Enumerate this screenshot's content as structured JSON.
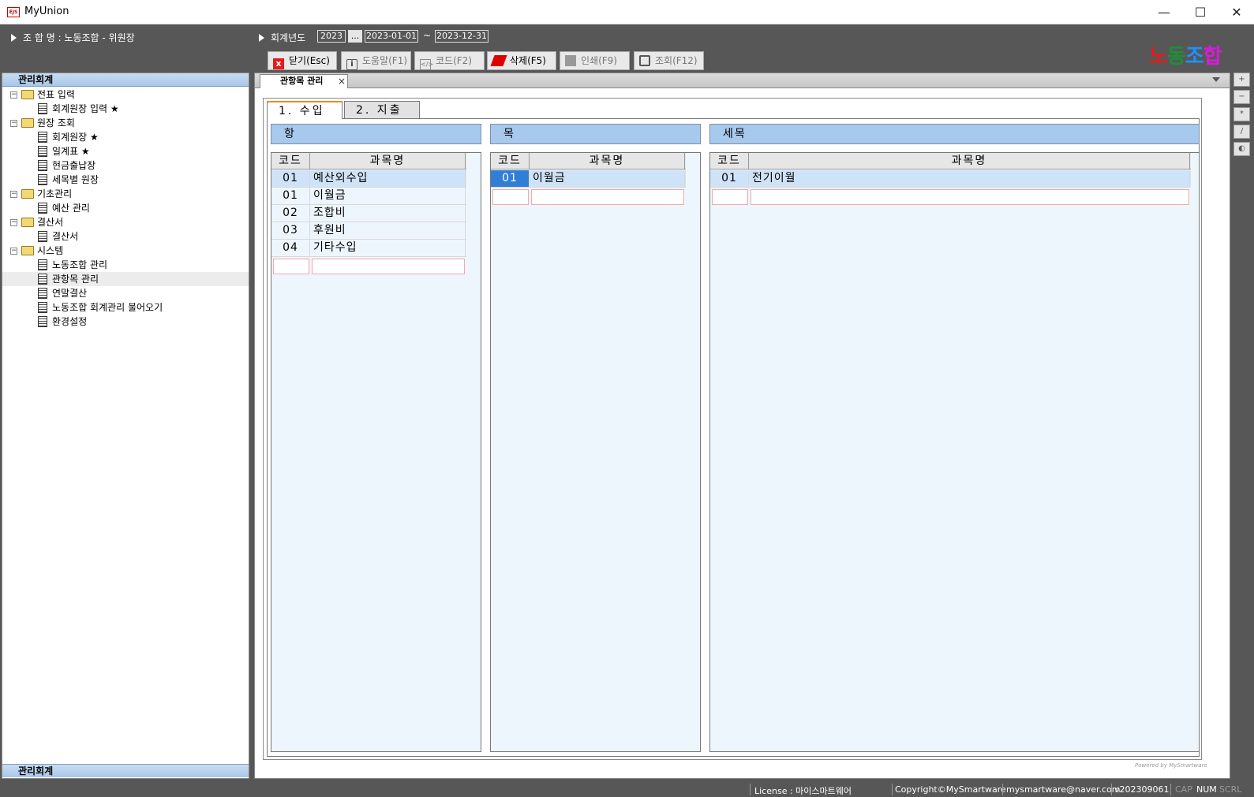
{
  "window": {
    "title": "MyUnion",
    "icon_text": "EJS",
    "minimize": "—",
    "maximize": "☐",
    "close": "✕"
  },
  "header": {
    "union_label": "조 합 명 : 노동조합 - 위원장",
    "fiscal_year_label": "회계년도",
    "fiscal_year": "2023",
    "picker": "...",
    "start_date": "2023-01-01",
    "tilde": "~",
    "end_date": "2023-12-31"
  },
  "toolbar": {
    "close": "닫기(Esc)",
    "help": "도움말(F1)",
    "code": "코드(F2)",
    "delete": "삭제(F5)",
    "print": "인쇄(F9)",
    "query": "조회(F12)"
  },
  "logo": {
    "p1": "노",
    "p2": "동",
    "p3": "조",
    "p4": "합"
  },
  "left_panel": {
    "title": "관리회계",
    "bottom_title": "관리회계",
    "tree": [
      {
        "label": "전표 입력",
        "level": 0,
        "type": "folder"
      },
      {
        "label": "회계원장 입력 ★",
        "level": 1,
        "type": "doc"
      },
      {
        "label": "원장 조회",
        "level": 0,
        "type": "folder"
      },
      {
        "label": "회계원장 ★",
        "level": 1,
        "type": "doc"
      },
      {
        "label": "일계표 ★",
        "level": 1,
        "type": "doc"
      },
      {
        "label": "현금출납장",
        "level": 1,
        "type": "doc"
      },
      {
        "label": "세목별 원장",
        "level": 1,
        "type": "doc"
      },
      {
        "label": "기초관리",
        "level": 0,
        "type": "folder"
      },
      {
        "label": "예산 관리",
        "level": 1,
        "type": "doc"
      },
      {
        "label": "결산서",
        "level": 0,
        "type": "folder"
      },
      {
        "label": "결산서",
        "level": 1,
        "type": "doc"
      },
      {
        "label": "시스템",
        "level": 0,
        "type": "folder"
      },
      {
        "label": "노동조합 관리",
        "level": 1,
        "type": "doc"
      },
      {
        "label": "관항목 관리",
        "level": 1,
        "type": "doc",
        "selected": true
      },
      {
        "label": "연말결산",
        "level": 1,
        "type": "doc"
      },
      {
        "label": "노동조합 회계관리 불어오기",
        "level": 1,
        "type": "doc"
      },
      {
        "label": "환경설정",
        "level": 1,
        "type": "doc"
      }
    ]
  },
  "doc_tab": {
    "label": "관항목 관리",
    "close": "×"
  },
  "subtabs": {
    "income": "1. 수입",
    "expense": "2. 지출"
  },
  "sections": {
    "hang": {
      "title": "항",
      "col_code": "코드",
      "col_name": "과목명",
      "rows": [
        {
          "code": "01",
          "name": "예산외수입",
          "selected": true
        },
        {
          "code": "01",
          "name": "이월금"
        },
        {
          "code": "02",
          "name": "조합비"
        },
        {
          "code": "03",
          "name": "후원비"
        },
        {
          "code": "04",
          "name": "기타수입"
        }
      ]
    },
    "mok": {
      "title": "목",
      "col_code": "코드",
      "col_name": "과목명",
      "rows": [
        {
          "code": "01",
          "name": "이월금",
          "selected": true,
          "focused": true
        }
      ]
    },
    "semok": {
      "title": "세목",
      "col_code": "코드",
      "col_name": "과목명",
      "rows": [
        {
          "code": "01",
          "name": "전기이월",
          "selected": true
        }
      ]
    }
  },
  "powered_by": "Powered by MySmartware",
  "side_tools": [
    "+",
    "−",
    "*",
    "/",
    "◐"
  ],
  "statusbar": {
    "license": "License : 마이스마트웨어",
    "copyright": "Copyright©MySmartware",
    "email": "mysmartware@naver.com",
    "version": "v202309061",
    "caps": "CAP",
    "num": "NUM",
    "scrl": "SCRL"
  }
}
